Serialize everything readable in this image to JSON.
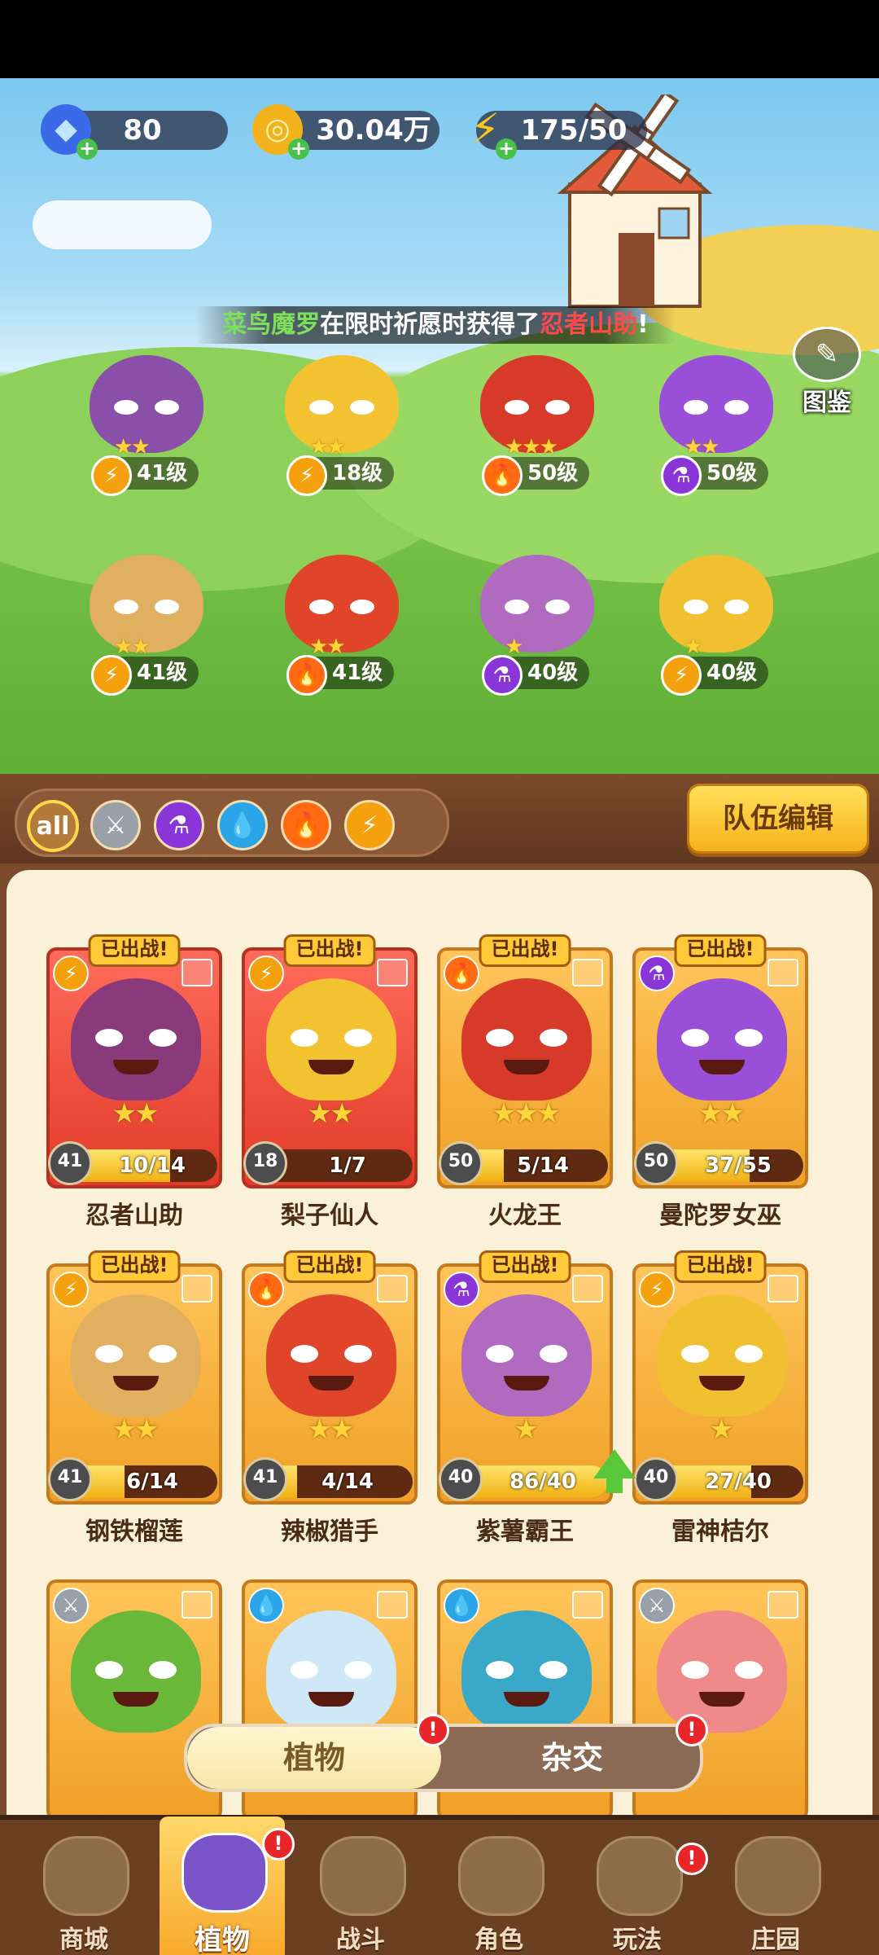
{
  "resources": {
    "gems": "80",
    "coins": "30.04万",
    "energy": "175/50"
  },
  "announcement": {
    "player": "菜鸟魔罗",
    "middle": "在限时祈愿时获得了",
    "hero": "忍者山助",
    "end": "!"
  },
  "atlas_label": "图鉴",
  "team_heroes": [
    {
      "element": "lightning",
      "stars": "★★",
      "level": "41级",
      "color": "#8a4fa8"
    },
    {
      "element": "lightning",
      "stars": "★★",
      "level": "18级",
      "color": "#f2c230"
    },
    {
      "element": "fire",
      "stars": "★★★",
      "level": "50级",
      "color": "#d83a2a"
    },
    {
      "element": "poison",
      "stars": "★★",
      "level": "50级",
      "color": "#9a4fd8"
    },
    {
      "element": "lightning",
      "stars": "★★",
      "level": "41级",
      "color": "#e0b060"
    },
    {
      "element": "fire",
      "stars": "★★",
      "level": "41级",
      "color": "#e0452a"
    },
    {
      "element": "poison",
      "stars": "★",
      "level": "40级",
      "color": "#b06ac0"
    },
    {
      "element": "lightning",
      "stars": "★",
      "level": "40级",
      "color": "#f0c030"
    }
  ],
  "filters": {
    "all_label": "all",
    "items": [
      "sword",
      "poison",
      "water",
      "fire",
      "lightning"
    ]
  },
  "team_edit_label": "队伍编辑",
  "deployed_label": "已出战!",
  "cards": [
    {
      "name": "忍者山助",
      "element": "lightning",
      "stars": "★★",
      "level": "41",
      "progress": "10/14",
      "fill": 0.71,
      "frame": "red",
      "color": "#8a3a7a",
      "deployed": true
    },
    {
      "name": "梨子仙人",
      "element": "lightning",
      "stars": "★★",
      "level": "18",
      "progress": "1/7",
      "fill": 0.14,
      "frame": "red",
      "color": "#f2c230",
      "deployed": true
    },
    {
      "name": "火龙王",
      "element": "fire",
      "stars": "★★★",
      "level": "50",
      "progress": "5/14",
      "fill": 0.36,
      "frame": "gold",
      "color": "#d83a2a",
      "deployed": true
    },
    {
      "name": "曼陀罗女巫",
      "element": "poison",
      "stars": "★★",
      "level": "50",
      "progress": "37/55",
      "fill": 0.67,
      "frame": "gold",
      "color": "#9a4fd8",
      "deployed": true
    },
    {
      "name": "钢铁榴莲",
      "element": "lightning",
      "stars": "★★",
      "level": "41",
      "progress": "6/14",
      "fill": 0.43,
      "frame": "gold",
      "color": "#e0b060",
      "deployed": true
    },
    {
      "name": "辣椒猎手",
      "element": "fire",
      "stars": "★★",
      "level": "41",
      "progress": "4/14",
      "fill": 0.29,
      "frame": "gold",
      "color": "#e0452a",
      "deployed": true
    },
    {
      "name": "紫薯霸王",
      "element": "poison",
      "stars": "★",
      "level": "40",
      "progress": "86/40",
      "fill": 1.0,
      "frame": "gold",
      "color": "#b06ac0",
      "deployed": true,
      "upgrade": true
    },
    {
      "name": "雷神桔尔",
      "element": "lightning",
      "stars": "★",
      "level": "40",
      "progress": "27/40",
      "fill": 0.68,
      "frame": "gold",
      "color": "#f0c030",
      "deployed": true
    },
    {
      "name": "",
      "element": "sword",
      "stars": "",
      "level": "",
      "progress": "",
      "fill": 0,
      "frame": "gold",
      "color": "#6ab83a",
      "deployed": false
    },
    {
      "name": "",
      "element": "water",
      "stars": "",
      "level": "",
      "progress": "",
      "fill": 0,
      "frame": "gold",
      "color": "#cfe8f8",
      "deployed": false
    },
    {
      "name": "",
      "element": "water",
      "stars": "",
      "level": "",
      "progress": "",
      "fill": 0,
      "frame": "gold",
      "color": "#3aa8c8",
      "deployed": false
    },
    {
      "name": "",
      "element": "sword",
      "stars": "",
      "level": "",
      "progress": "",
      "fill": 0,
      "frame": "gold",
      "color": "#f08a8a",
      "deployed": false
    }
  ],
  "toggle": {
    "plants": "植物",
    "hybrid": "杂交"
  },
  "nav": [
    {
      "label": "商城",
      "icon": "shop-icon"
    },
    {
      "label": "植物",
      "icon": "plant-icon",
      "active": true
    },
    {
      "label": "战斗",
      "icon": "battle-icon"
    },
    {
      "label": "角色",
      "icon": "character-icon"
    },
    {
      "label": "玩法",
      "icon": "gameplay-icon"
    },
    {
      "label": "庄园",
      "icon": "manor-icon"
    }
  ],
  "alert_mark": "!"
}
